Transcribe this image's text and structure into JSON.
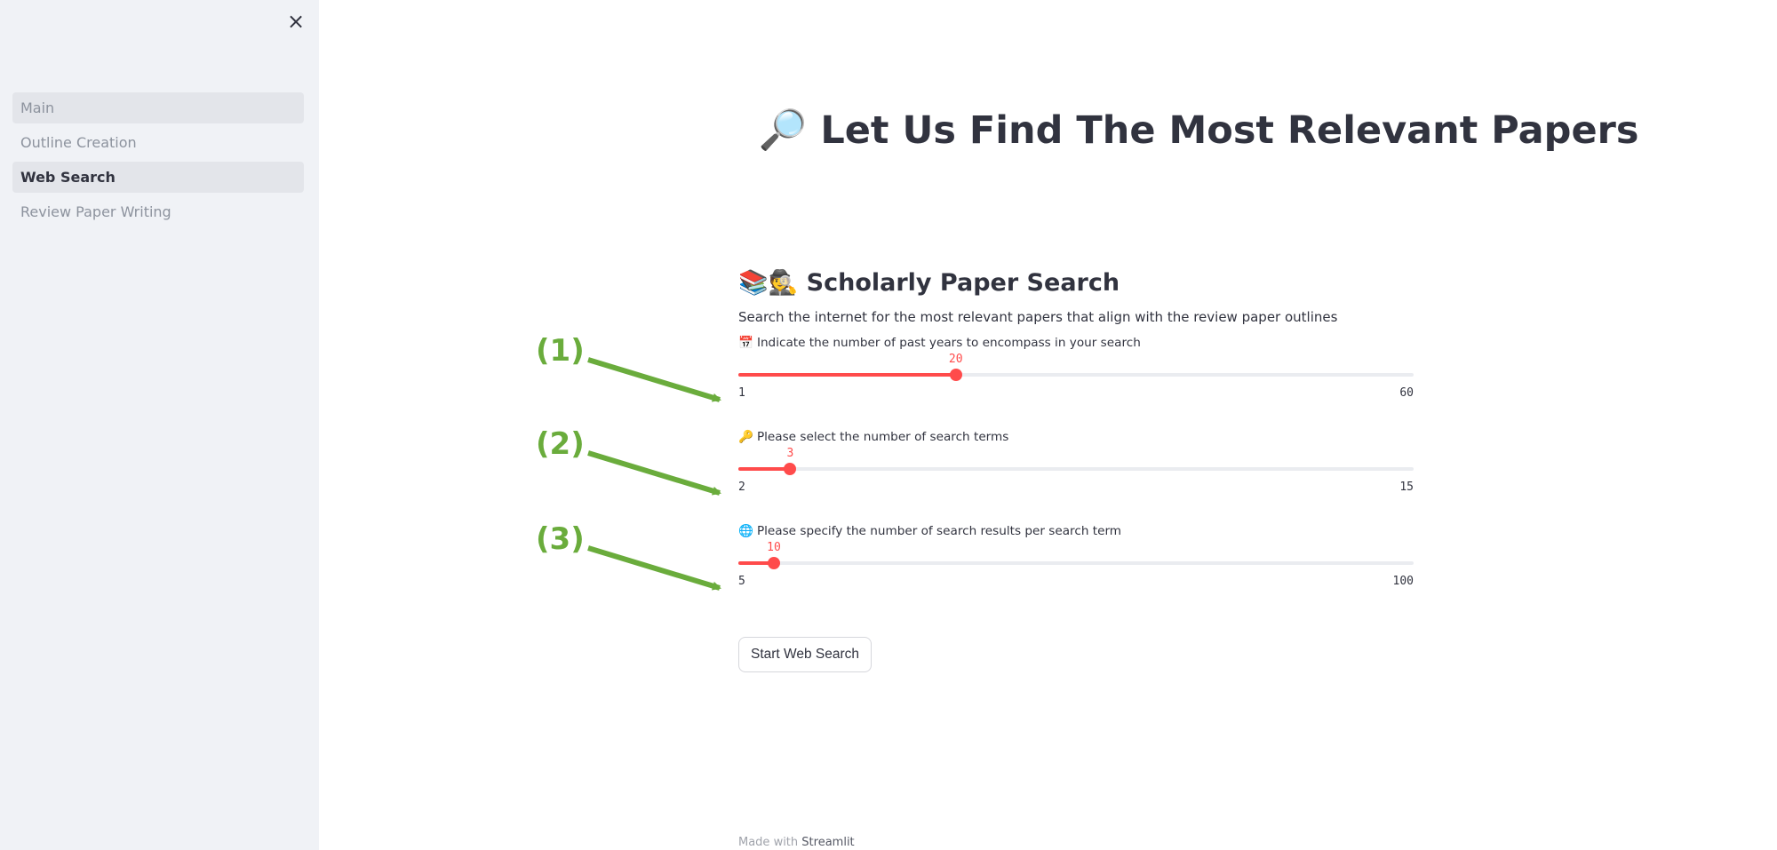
{
  "sidebar": {
    "close_icon": "×",
    "nav_items": [
      {
        "label": "Main"
      },
      {
        "label": "Outline Creation"
      },
      {
        "label": "Web Search",
        "active": true
      },
      {
        "label": "Review Paper Writing"
      }
    ]
  },
  "main": {
    "title_emoji": "🔎",
    "title": "Let Us Find The Most Relevant Papers",
    "section": {
      "emoji": "📚🕵️",
      "title": "Scholarly Paper Search",
      "description": "Search the internet for the most relevant papers that align with the review paper outlines"
    },
    "sliders": [
      {
        "icon": "📅",
        "label": "Indicate the number of past years to encompass in your search",
        "value": "20",
        "min": "1",
        "max": "60"
      },
      {
        "icon": "🔑",
        "label": "Please select the number of search terms",
        "value": "3",
        "min": "2",
        "max": "15"
      },
      {
        "icon": "🌐",
        "label": "Please specify the number of search results per search term",
        "value": "10",
        "min": "5",
        "max": "100"
      }
    ],
    "start_button": "Start Web Search",
    "footer": {
      "prefix": "Made with",
      "brand": "Streamlit"
    }
  },
  "annotations": [
    "(1)",
    "(2)",
    "(3)"
  ],
  "colors": {
    "accent": "#ff4b4b",
    "annotation": "#6aac3c",
    "sidebar_bg": "#f0f2f6"
  }
}
